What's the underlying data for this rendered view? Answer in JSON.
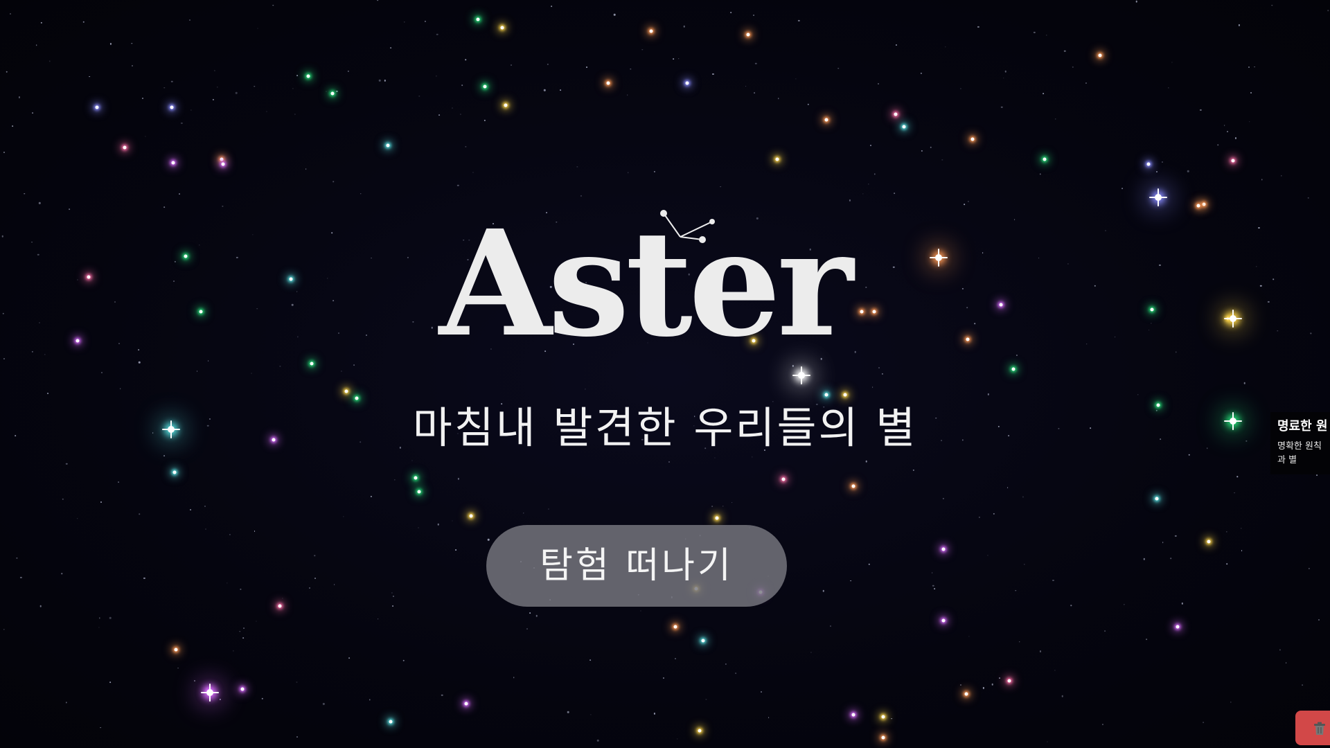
{
  "app": {
    "logo_text": "Aster",
    "tagline": "마침내 발견한 우리들의 별",
    "explore_button_label": "탐험 떠나기"
  },
  "tooltip": {
    "title": "명료한 원",
    "description": "명확한 원칙과 별"
  },
  "icons": {
    "trash": "trash-icon",
    "constellation": "constellation-icon",
    "sparkle": "sparkle-icon"
  },
  "colors": {
    "background": "#05050f",
    "logo": "#ececec",
    "button_bg": "#78787f",
    "trash_button_bg": "#d24848",
    "star_palette": [
      "#ff6fa8",
      "#8a8cff",
      "#27e07a",
      "#ffd84a",
      "#ff9a55",
      "#d96bff",
      "#58e0e0",
      "#ffffff"
    ]
  }
}
